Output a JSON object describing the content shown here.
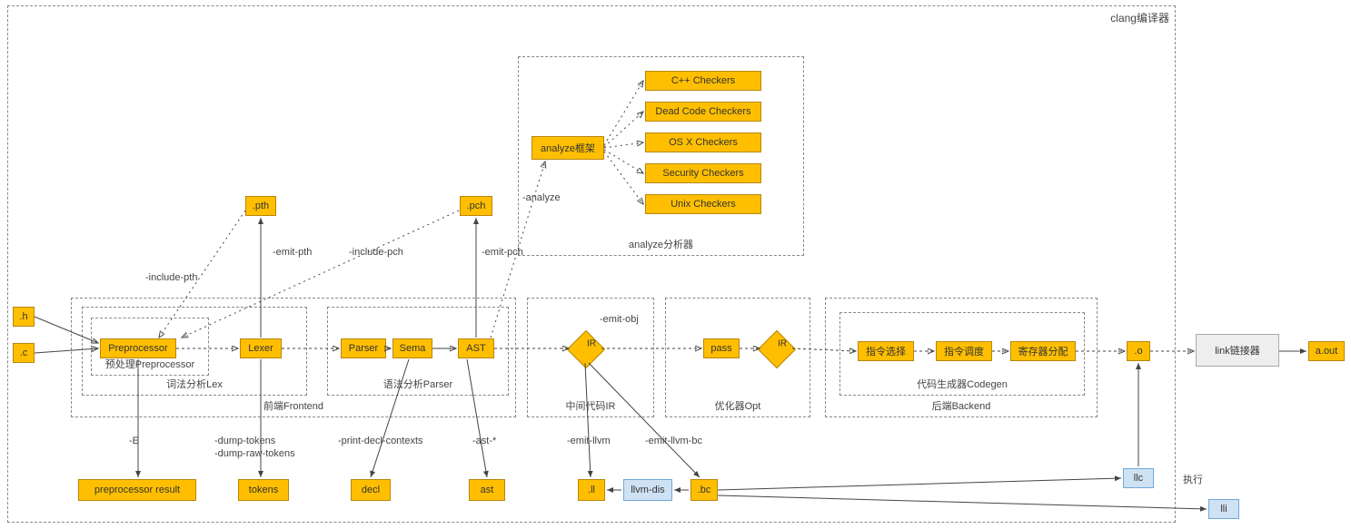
{
  "outer": {
    "title": "clang编译器"
  },
  "inputs": {
    "h": ".h",
    "c": ".c"
  },
  "frontend": {
    "group_label": "前端Frontend",
    "lex_group": "词法分析Lex",
    "pp_group": "预处理Preprocessor",
    "parser_group": "语法分析Parser",
    "pp": "Preprocessor",
    "lexer": "Lexer",
    "parser": "Parser",
    "sema": "Sema",
    "ast": "AST",
    "pth": ".pth",
    "pch": ".pch"
  },
  "ir": {
    "group_label": "中间代码IR",
    "ir": "IR"
  },
  "opt": {
    "group_label": "优化器Opt",
    "pass": "pass",
    "ir": "IR"
  },
  "codegen": {
    "group_label": "代码生成器Codegen",
    "backend_label": "后端Backend",
    "isel": "指令选择",
    "isched": "指令调度",
    "regalloc": "寄存器分配"
  },
  "analyze": {
    "group_label": "analyze分析器",
    "frame": "analyze框架",
    "checkers": [
      "C++ Checkers",
      "Dead Code Checkers",
      "OS X Checkers",
      "Security Checkers",
      "Unix Checkers"
    ]
  },
  "outputs": {
    "pp_result": "preprocessor result",
    "tokens": "tokens",
    "decl": "decl",
    "ast": "ast",
    "ll": ".ll",
    "bc": ".bc",
    "o": ".o",
    "llvm_dis": "llvm-dis",
    "llc": "llc",
    "lli": "lli",
    "link": "link链接器",
    "aout": "a.out"
  },
  "edges": {
    "include_pth": "-include-pth",
    "emit_pth": "-emit-pth",
    "include_pch": "-include-pch",
    "emit_pch": "-emit-pch",
    "analyze": "-analyze",
    "E": "-E",
    "dump_tokens": "-dump-tokens",
    "dump_raw_tokens": "-dump-raw-tokens",
    "print_decl": "-print-decl-contexts",
    "ast_star": "-ast-*",
    "emit_obj": "-emit-obj",
    "emit_llvm": "-emit-llvm",
    "emit_llvm_bc": "-emit-llvm-bc",
    "exec": "执行"
  },
  "watermark": ""
}
